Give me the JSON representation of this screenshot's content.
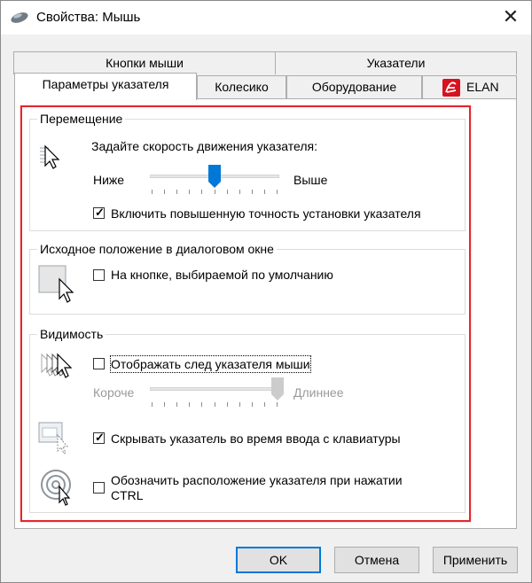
{
  "window": {
    "title": "Свойства: Мышь",
    "close_glyph": "✕",
    "accent_color": "#0078d7",
    "highlight_color": "#e3262e"
  },
  "tabs": {
    "row1": [
      {
        "label": "Кнопки мыши"
      },
      {
        "label": "Указатели"
      }
    ],
    "row2": [
      {
        "label": "Параметры указателя",
        "active": true
      },
      {
        "label": "Колесико"
      },
      {
        "label": "Оборудование"
      },
      {
        "label": "ELAN"
      }
    ]
  },
  "motion": {
    "legend": "Перемещение",
    "prompt": "Задайте скорость движения указателя:",
    "slow_label": "Ниже",
    "fast_label": "Выше",
    "speed_level": 0.5,
    "precision_label": "Включить повышенную точность установки указателя",
    "precision_checked": true
  },
  "snap": {
    "legend": "Исходное положение в диалоговом окне",
    "label": "На кнопке, выбираемой по умолчанию",
    "checked": false
  },
  "visibility": {
    "legend": "Видимость",
    "trails_label": "Отображать след указателя мыши",
    "trails_checked": false,
    "short_label": "Короче",
    "long_label": "Длиннее",
    "trail_level": 1.0,
    "hide_label": "Скрывать указатель во время ввода с клавиатуры",
    "hide_checked": true,
    "ctrl_label_line1": "Обозначить расположение указателя при нажатии",
    "ctrl_label_line2": "CTRL",
    "ctrl_checked": false
  },
  "buttons": {
    "ok": "OK",
    "cancel": "Отмена",
    "apply": "Применить"
  }
}
